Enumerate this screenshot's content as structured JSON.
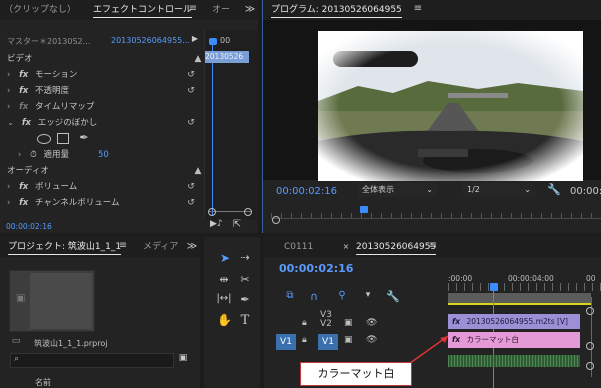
{
  "effect_controls": {
    "tab_clip_mixer": "（クリップなし）",
    "tab_effect_controls": "エフェクトコントロール",
    "tab_audio": "オー",
    "overflow": "≫",
    "master_label": "マスター＊20130S2...",
    "clip_label": "20130526064955...",
    "time_ruler": "00",
    "timeline_clip": "20130526",
    "sections": {
      "video": "ビデオ",
      "audio": "オーディオ"
    },
    "effects": {
      "motion": "モーション",
      "opacity": "不透明度",
      "time_remap": "タイムリマップ",
      "edge_feather": "エッジのぼかし",
      "amount_label": "適用量",
      "amount_value": "50",
      "volume": "ボリューム",
      "channel_volume": "チャンネルボリューム"
    },
    "timecode": "00:00:02:16"
  },
  "program_monitor": {
    "title": "プログラム: 20130526064955",
    "timecode": "00:00:02:16",
    "zoom": "全体表示",
    "resolution": "1/2",
    "duration": "00:00:09"
  },
  "project": {
    "tab_project": "プロジェクト: 筑波山1_1_1",
    "tab_media": "メディア",
    "overflow": "≫",
    "filename": "筑波山1_1_1.prproj",
    "name_column": "名前"
  },
  "timeline": {
    "tab_c0111": "C0111",
    "tab_sequence": "20130526064955",
    "timecode": "00:00:02:16",
    "ruler_start": ":00:00",
    "ruler_mid": "00:00:04:00",
    "ruler_end": "00",
    "tracks": {
      "v3": "V3",
      "v2": "V2",
      "v1": "V1",
      "v1_source": "V1"
    },
    "clip_video": "20130526064955.m2ts [V]",
    "clip_matte": "カラーマット白"
  },
  "tooltip": "カラーマット白",
  "colors": {
    "accent_blue": "#5a9bff",
    "clip_pink": "#e59ad8",
    "clip_violet": "#9d8fd6",
    "yellow_bar": "#d7d61a",
    "tooltip_border": "#c03a3a"
  }
}
